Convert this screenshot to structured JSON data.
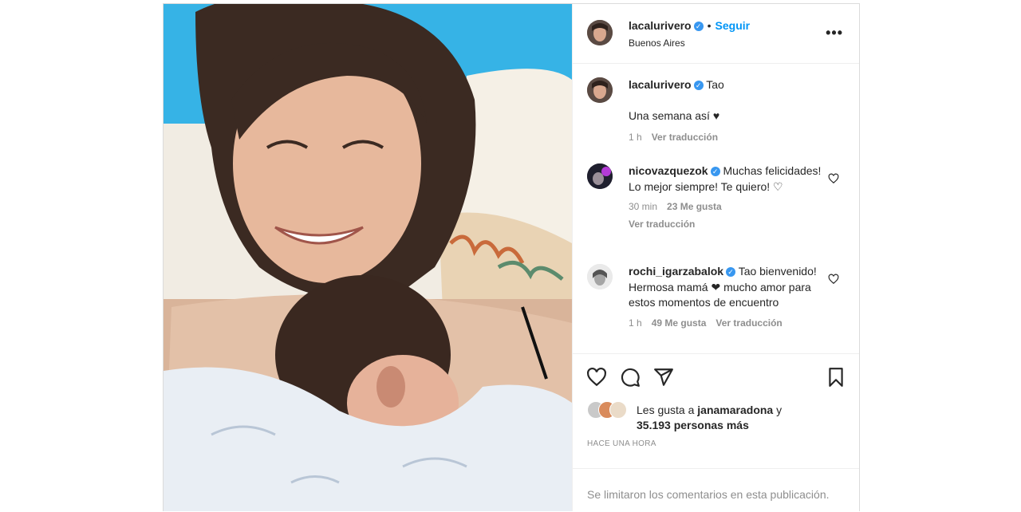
{
  "header": {
    "username": "lacalurivero",
    "dot": "•",
    "follow_label": "Seguir",
    "location": "Buenos Aires",
    "more_label": "•••"
  },
  "caption": {
    "username": "lacalurivero",
    "first_line": "Tao",
    "text": "Una semana así ♥",
    "time": "1 h",
    "translate": "Ver traducción"
  },
  "comments": [
    {
      "username": "nicovazquezok",
      "text": "Muchas felicidades! Lo mejor siempre! Te quiero! ♡",
      "time": "30 min",
      "likes": "23 Me gusta",
      "translate": "Ver traducción"
    },
    {
      "username": "rochi_igarzabalok",
      "text": "Tao bienvenido! Hermosa mamá ❤ mucho amor para estos momentos de encuentro",
      "time": "1 h",
      "likes": "49 Me gusta",
      "translate": "Ver traducción"
    }
  ],
  "likes": {
    "prefix": "Les gusta a",
    "user": "janamaradona",
    "conj": "y",
    "count": "35.193 personas más"
  },
  "timestamp": "Hace una hora",
  "comments_limited": "Se limitaron los comentarios en esta publicación.",
  "icons": [
    "heart-icon",
    "comment-icon",
    "share-icon",
    "bookmark-icon",
    "more-icon",
    "verified-icon"
  ],
  "colors": {
    "accent": "#0095f6",
    "verified": "#3897f0",
    "muted": "#8e8e8e"
  }
}
